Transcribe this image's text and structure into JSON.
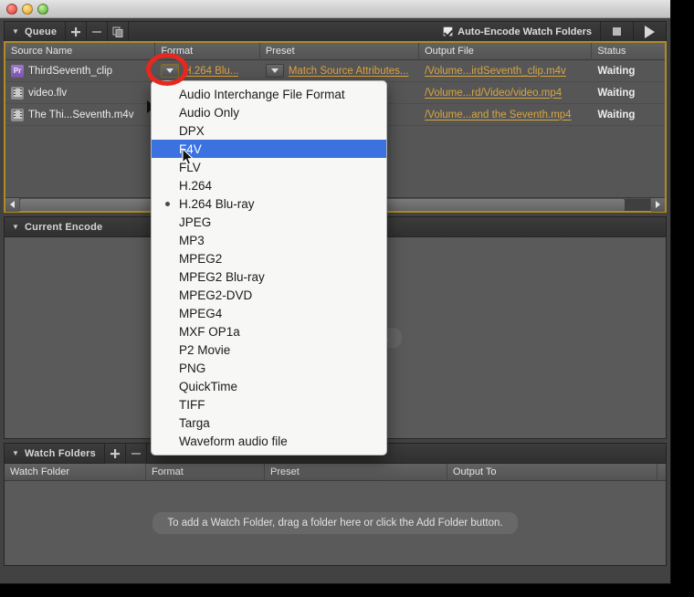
{
  "window": {
    "traffic_lights": [
      "close",
      "minimize",
      "zoom"
    ]
  },
  "queue": {
    "title": "Queue",
    "toolbar": {
      "add_label": "+",
      "remove_label": "–",
      "duplicate_label": "duplicate",
      "auto_encode_label": "Auto-Encode Watch Folders",
      "auto_encode_checked": true,
      "stop_label": "Stop",
      "start_label": "Start Queue"
    },
    "columns": [
      "Source Name",
      "Format",
      "Preset",
      "Output File",
      "Status"
    ],
    "rows": [
      {
        "icon": "premiere-pro-badge",
        "icon_label": "Pr",
        "source_name": "ThirdSeventh_clip",
        "format": "H.264 Blu...",
        "preset": "Match Source Attributes...",
        "output_file": "/Volume...irdSeventh_clip.m4v",
        "status": "Waiting"
      },
      {
        "icon": "media-file-badge",
        "icon_label": "",
        "source_name": "video.flv",
        "format": "",
        "preset": "",
        "output_file": "/Volume...rd/Video/video.mp4",
        "status": "Waiting"
      },
      {
        "icon": "media-file-badge",
        "icon_label": "",
        "source_name": "The Thi...Seventh.m4v",
        "format": "",
        "preset": "",
        "output_file": "/Volume...and the Seventh.mp4",
        "status": "Waiting"
      }
    ]
  },
  "format_menu": {
    "selected": "F4V",
    "checked": "H.264 Blu-ray",
    "items": [
      "Audio Interchange File Format",
      "Audio Only",
      "DPX",
      "F4V",
      "FLV",
      "H.264",
      "H.264 Blu-ray",
      "JPEG",
      "MP3",
      "MPEG2",
      "MPEG2 Blu-ray",
      "MPEG2-DVD",
      "MPEG4",
      "MXF OP1a",
      "P2 Movie",
      "PNG",
      "QuickTime",
      "TIFF",
      "Targa",
      "Waveform audio file"
    ]
  },
  "current_encode": {
    "title": "Current Encode",
    "empty_message": "Not currently encoding."
  },
  "watch_folders": {
    "title": "Watch Folders",
    "toolbar": {
      "add_label": "+",
      "remove_label": "–"
    },
    "columns": [
      "Watch Folder",
      "Format",
      "Preset",
      "Output To"
    ],
    "empty_message": "To add a Watch Folder, drag a folder here or click the Add Folder button."
  },
  "colors": {
    "accent_link": "#e0a43c",
    "selection_blue": "#3b72e0",
    "focus_border": "#b08a26",
    "annotation_red": "#e8271e"
  }
}
